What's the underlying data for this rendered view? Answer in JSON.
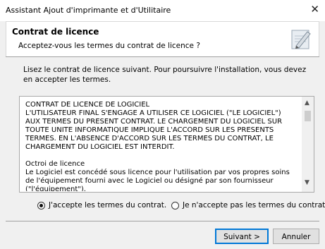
{
  "window": {
    "title": "Assistant Ajout d'imprimante et d'Utilitaire",
    "close_glyph": "✕"
  },
  "header": {
    "title": "Contrat de licence",
    "subtitle": "Acceptez-vous les termes du contrat de licence ?",
    "icon": "wizard-document-icon"
  },
  "instructions": "Lisez le contrat de licence suivant. Pour poursuivre l'installation, vous devez en accepter les termes.",
  "license": {
    "text": "CONTRAT DE LICENCE DE LOGICIEL\nL'UTILISATEUR FINAL S'ENGAGE A UTILISER CE LOGICIEL (\"LE LOGICIEL\") AUX TERMES DU PRESENT CONTRAT. LE CHARGEMENT DU LOGICIEL SUR TOUTE UNITE INFORMATIQUE IMPLIQUE L'ACCORD SUR LES PRESENTS TERMES. EN L'ABSENCE D'ACCORD SUR LES TERMES DU CONTRAT, LE CHARGEMENT DU LOGICIEL EST INTERDIT.\n\nOctroi de licence\nLe Logiciel est concédé sous licence pour l'utilisation par vos propres soins de l'équipement fourni avec le Logiciel ou désigné par son fournisseur (\"l'équipement\")."
  },
  "options": {
    "accept_label": "J'accepte les termes du contrat.",
    "decline_label": "Je n'accepte pas les termes du contrat.",
    "selected": "accept"
  },
  "buttons": {
    "next_label": "Suivant >",
    "cancel_label": "Annuler"
  }
}
